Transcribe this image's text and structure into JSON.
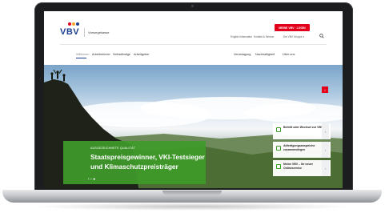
{
  "header": {
    "logo": "VBV",
    "brand_sub": "Vorsorgekasse",
    "login_label": "MEINE VBV · LOGIN",
    "util_links": [
      "English information",
      "Kontakt & Service",
      "Die VBV Gruppe ▾"
    ]
  },
  "nav": {
    "items": [
      "Willkomm",
      "Arbeitnehmer",
      "Selbständige",
      "Arbeitgeber"
    ],
    "right_items": [
      "Veranlagung",
      "Nachhaltigkeit",
      "Über uns"
    ]
  },
  "hero": {
    "eyebrow": "AUSGEZEICHNETE QUALITÄT",
    "headline": "Staatspreisgewinner, VKI-Testsieger und Klimaschutzpreisträger",
    "slider": "‹ › ●",
    "badge": "☆"
  },
  "cards": [
    {
      "label": "Beitritt oder Wechsel zur VBV",
      "arrow": "›"
    },
    {
      "label": "Abfertigungsansprüche zusammenlegen",
      "arrow": "›"
    },
    {
      "label": "Meine VBV – Ihr neuer Onlineservice",
      "arrow": "›"
    }
  ],
  "colors": {
    "brand_blue": "#1a3f8f",
    "accent_red": "#e2001a",
    "hero_green": "#3e9a2a"
  },
  "icons": [
    "search-icon",
    "user-icon",
    "star-icon",
    "chevron-right-icon"
  ]
}
